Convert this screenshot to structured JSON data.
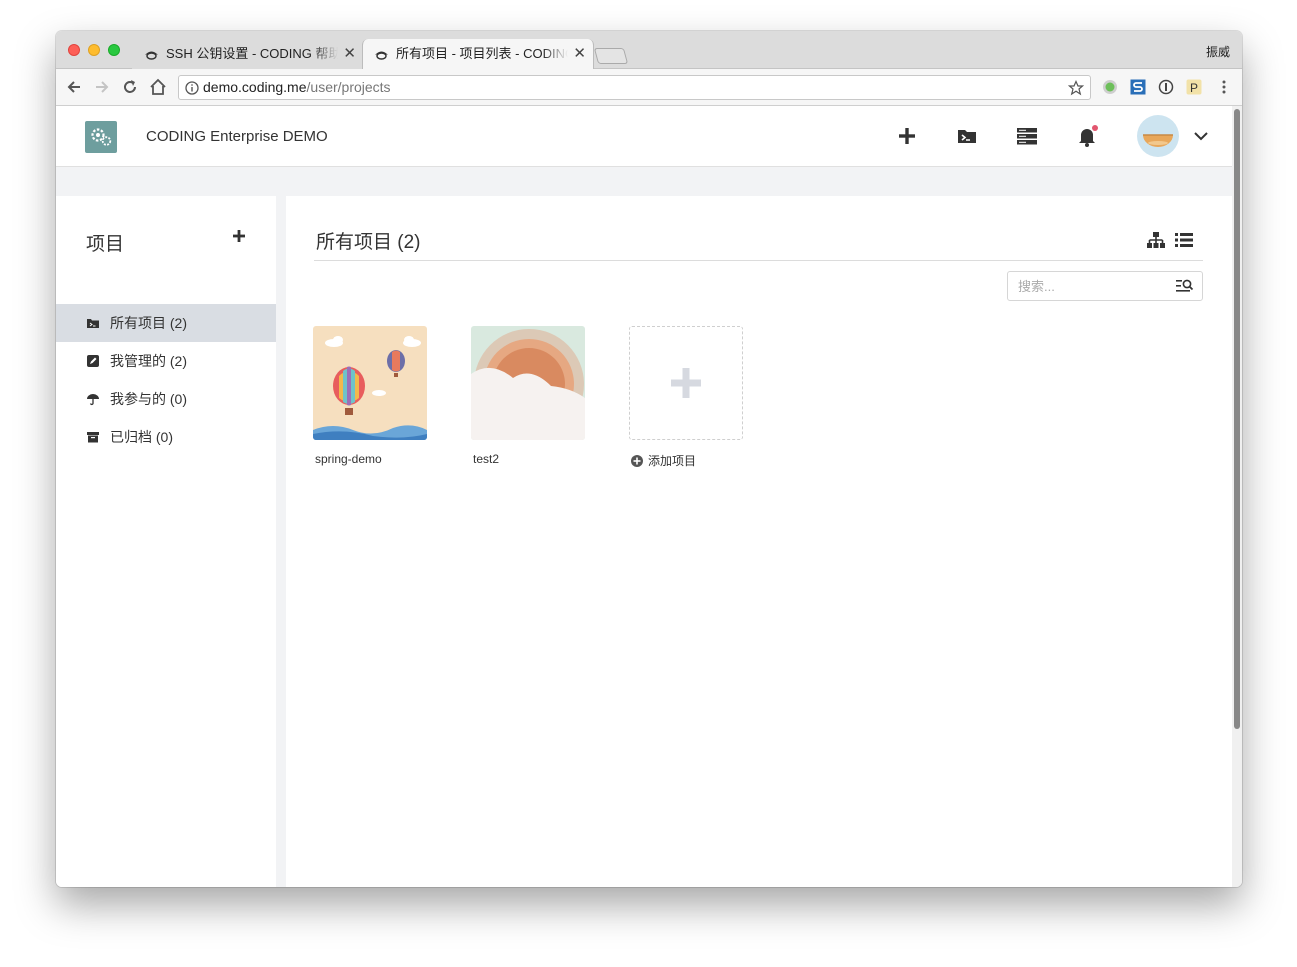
{
  "browser": {
    "tabs": [
      {
        "title": "SSH 公钥设置 - CODING 帮助中心",
        "icon": "penguin-favicon",
        "active": false
      },
      {
        "title": "所有项目 - 项目列表 - CODING",
        "icon": "penguin-favicon",
        "active": true
      }
    ],
    "profile_name": "振威",
    "url_host": "demo.coding.me",
    "url_path": "/user/projects",
    "icons": [
      "back-icon",
      "forward-icon",
      "reload-icon",
      "home-icon",
      "info-icon",
      "star-icon",
      "menu-dots-icon"
    ],
    "extensions": [
      "green-dot-extension",
      "s-extension",
      "1password-extension",
      "p-extension"
    ]
  },
  "header": {
    "brand": "CODING Enterprise DEMO",
    "logo_icon": "gears-logo-icon",
    "icons": [
      "plus-icon",
      "folder-terminal-icon",
      "servers-icon",
      "bell-icon",
      "avatar",
      "chevron-down-icon"
    ],
    "notification_dot_color": "#e2566f"
  },
  "sidebar": {
    "title": "项目",
    "add_icon": "plus-icon",
    "items": [
      {
        "label": "所有项目 (2)",
        "icon": "folder-terminal-icon",
        "active": true
      },
      {
        "label": "我管理的 (2)",
        "icon": "edit-icon",
        "active": false
      },
      {
        "label": "我参与的 (0)",
        "icon": "umbrella-icon",
        "active": false
      },
      {
        "label": "已归档 (0)",
        "icon": "archive-icon",
        "active": false
      }
    ]
  },
  "main": {
    "title": "所有项目 (2)",
    "view_icons": [
      "tree-view-icon",
      "list-view-icon"
    ],
    "search_placeholder": "搜索...",
    "search_value": "",
    "projects": [
      {
        "name": "spring-demo",
        "cover": "hot-air-balloon"
      },
      {
        "name": "test2",
        "cover": "sun-clouds"
      }
    ],
    "add_label": "添加项目"
  },
  "colors": {
    "active_bg": "#d9dde3",
    "page_gray": "#f2f3f5",
    "logo_bg": "#6e9e9e"
  }
}
